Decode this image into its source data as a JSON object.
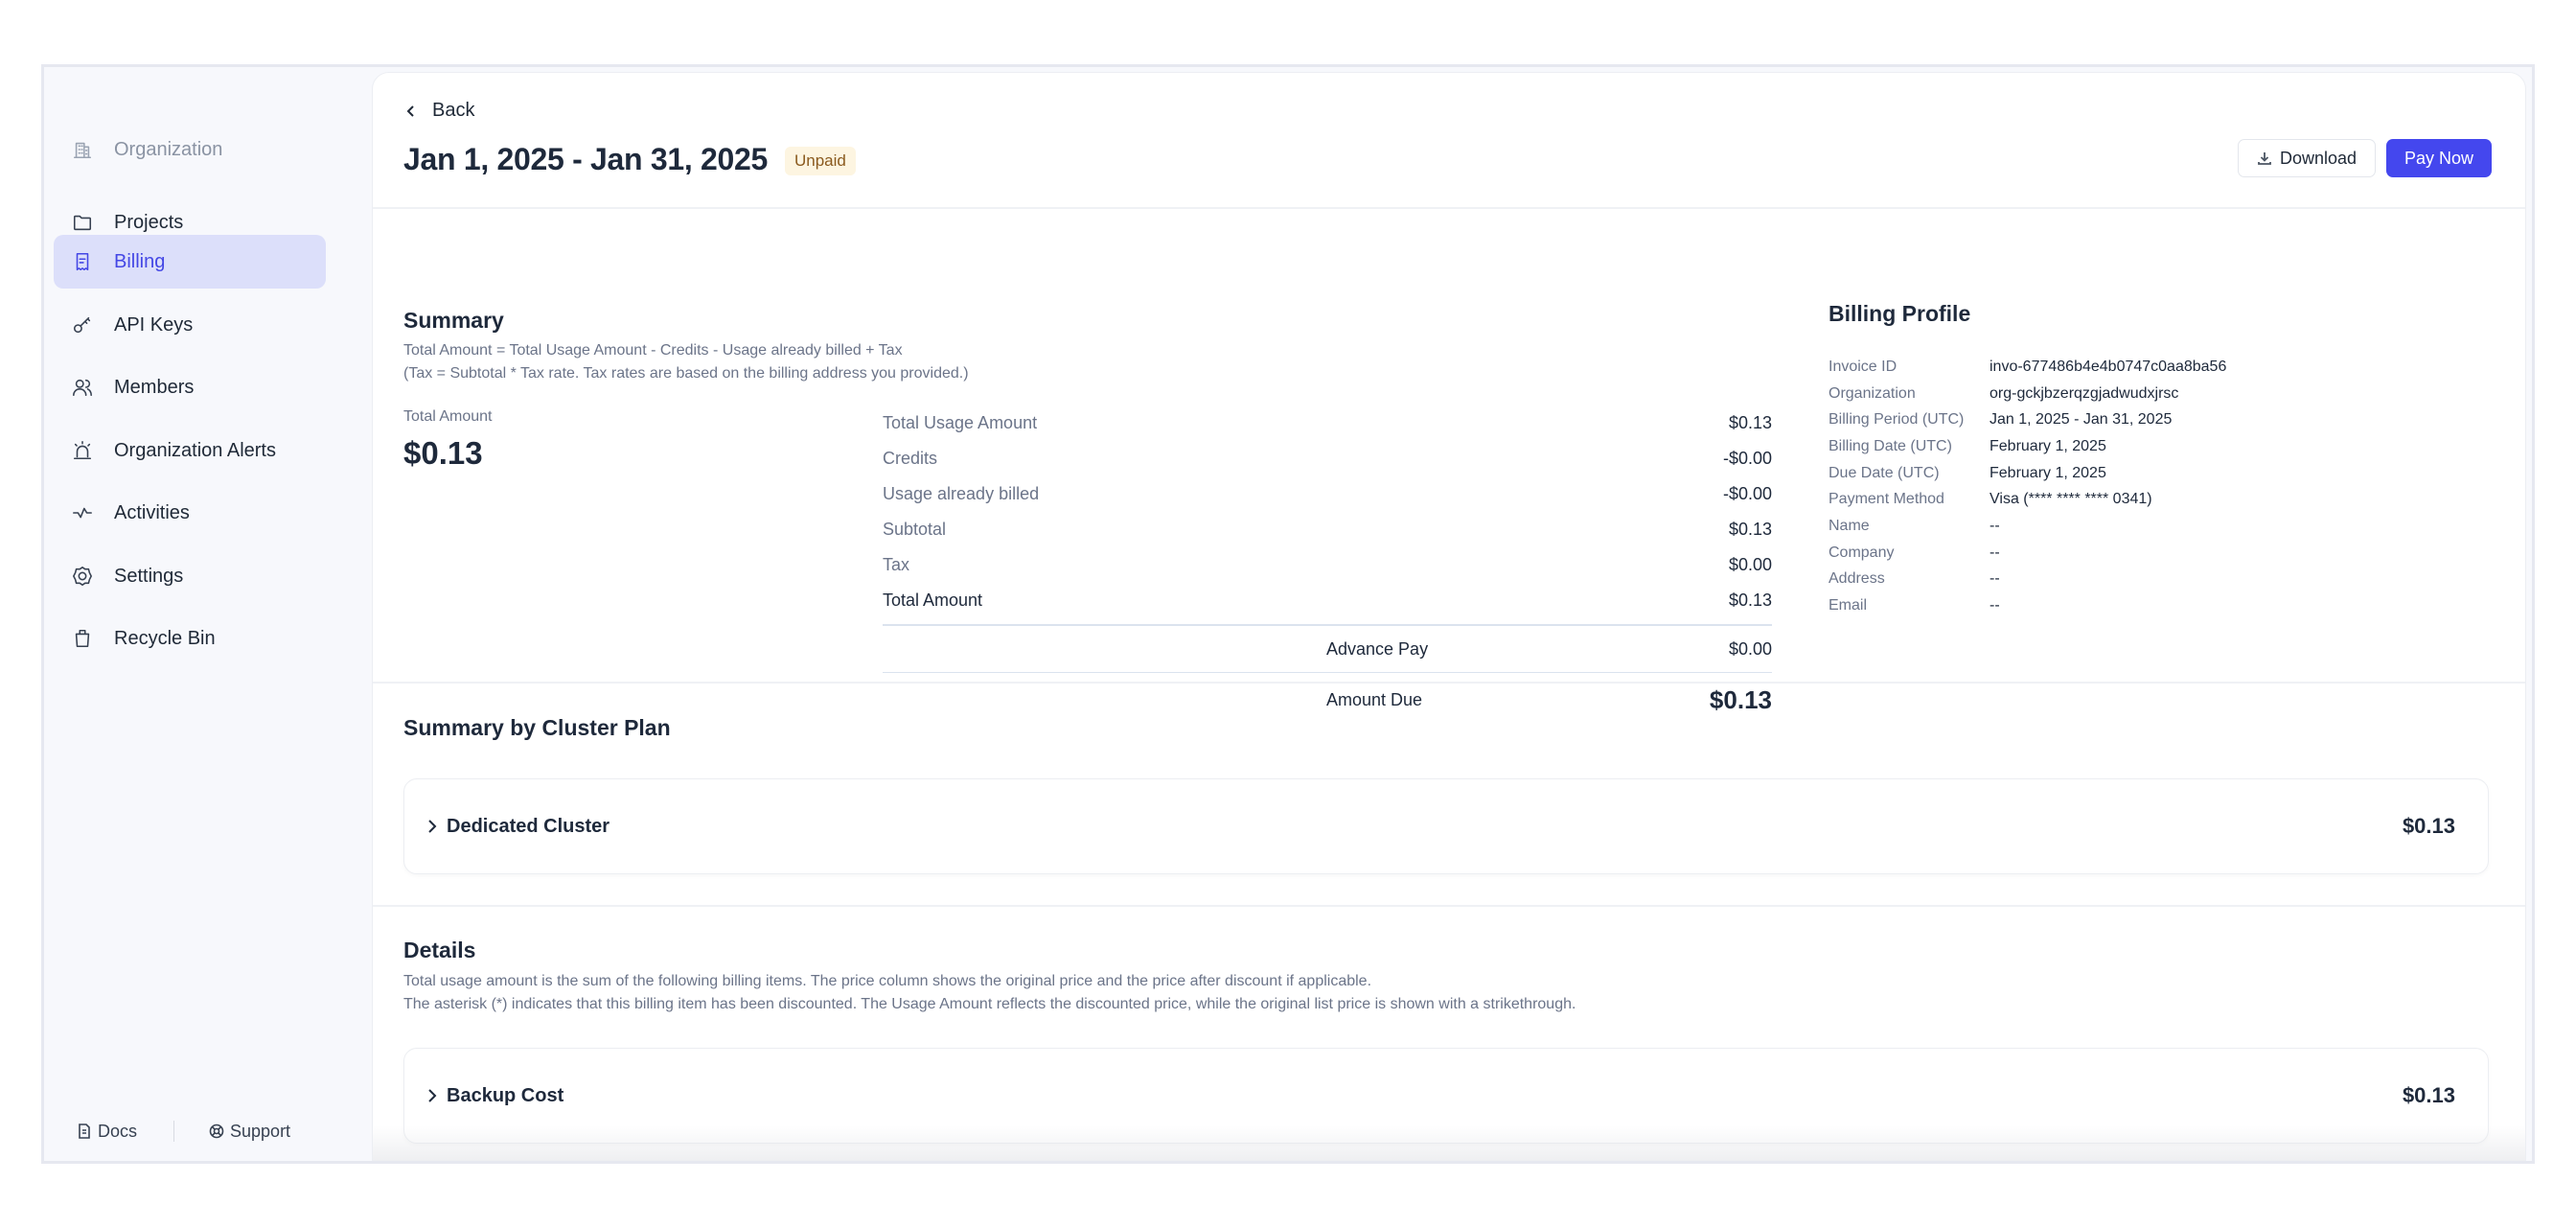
{
  "sidebar": {
    "items": [
      {
        "label": "Organization",
        "icon": "building-icon"
      },
      {
        "label": "Projects",
        "icon": "folder-icon"
      },
      {
        "label": "Billing",
        "icon": "receipt-icon",
        "active": true
      },
      {
        "label": "API Keys",
        "icon": "key-icon"
      },
      {
        "label": "Members",
        "icon": "users-icon"
      },
      {
        "label": "Organization Alerts",
        "icon": "siren-icon"
      },
      {
        "label": "Activities",
        "icon": "activity-icon"
      },
      {
        "label": "Settings",
        "icon": "gear-icon"
      },
      {
        "label": "Recycle Bin",
        "icon": "trash-icon"
      }
    ],
    "footer": {
      "docs": "Docs",
      "support": "Support"
    }
  },
  "header": {
    "back": "Back",
    "title": "Jan 1, 2025 - Jan 31, 2025",
    "status": "Unpaid",
    "download": "Download",
    "pay_now": "Pay Now"
  },
  "colors": {
    "accent": "#4447ee",
    "badge_bg": "#fdf5e1",
    "badge_text": "#8a5a1e",
    "active_nav_bg": "#dcdffa"
  },
  "summary": {
    "title": "Summary",
    "formula": "Total Amount = Total Usage Amount - Credits - Usage already billed + Tax",
    "tax_note": "(Tax = Subtotal * Tax rate. Tax rates are based on the billing address you provided.)",
    "total_label": "Total Amount",
    "total_value": "$0.13",
    "rows": [
      {
        "label": "Total Usage Amount",
        "value": "$0.13"
      },
      {
        "label": "Credits",
        "value": "-$0.00"
      },
      {
        "label": "Usage already billed",
        "value": "-$0.00"
      },
      {
        "label": "Subtotal",
        "value": "$0.13"
      },
      {
        "label": "Tax",
        "value": "$0.00"
      },
      {
        "label": "Total Amount",
        "value": "$0.13"
      }
    ],
    "advance_pay": {
      "label": "Advance Pay",
      "value": "$0.00"
    },
    "amount_due": {
      "label": "Amount Due",
      "value": "$0.13"
    }
  },
  "billing_profile": {
    "title": "Billing Profile",
    "rows": [
      {
        "label": "Invoice ID",
        "value": "invo-677486b4e4b0747c0aa8ba56"
      },
      {
        "label": "Organization",
        "value": "org-gckjbzerqzgjadwudxjrsc"
      },
      {
        "label": "Billing Period (UTC)",
        "value": "Jan 1, 2025 - Jan 31, 2025"
      },
      {
        "label": "Billing Date (UTC)",
        "value": "February 1, 2025"
      },
      {
        "label": "Due Date (UTC)",
        "value": "February 1, 2025"
      },
      {
        "label": "Payment Method",
        "value": "Visa (**** **** **** 0341)"
      },
      {
        "label": "Name",
        "value": "--"
      },
      {
        "label": "Company",
        "value": "--"
      },
      {
        "label": "Address",
        "value": "--"
      },
      {
        "label": "Email",
        "value": "--"
      }
    ]
  },
  "cluster_plan": {
    "title": "Summary by Cluster Plan",
    "items": [
      {
        "name": "Dedicated Cluster",
        "amount": "$0.13"
      }
    ]
  },
  "details": {
    "title": "Details",
    "line1": "Total usage amount is the sum of the following billing items. The price column shows the original price and the price after discount if applicable.",
    "line2": "The asterisk (*) indicates that this billing item has been discounted. The Usage Amount reflects the discounted price, while the original list price is shown with a strikethrough.",
    "items": [
      {
        "name": "Backup Cost",
        "amount": "$0.13"
      }
    ]
  }
}
